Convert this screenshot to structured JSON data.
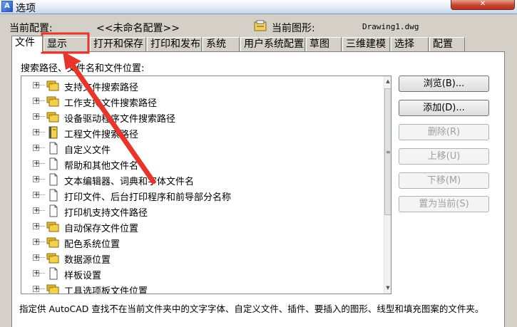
{
  "window": {
    "title": "选项",
    "app_icon_text": "A",
    "close_glyph": "✕"
  },
  "config": {
    "current_profile_label": "当前配置:",
    "current_profile_value": "<<未命名配置>>",
    "current_drawing_label": "当前图形:",
    "current_drawing_value": "Drawing1.dwg"
  },
  "tabs": [
    {
      "label": "文件"
    },
    {
      "label": "显示"
    },
    {
      "label": "打开和保存"
    },
    {
      "label": "打印和发布"
    },
    {
      "label": "系统"
    },
    {
      "label": "用户系统配置"
    },
    {
      "label": "草图"
    },
    {
      "label": "三维建模"
    },
    {
      "label": "选择"
    },
    {
      "label": "配置"
    }
  ],
  "active_tab": "文件",
  "highlighted_tab": "显示",
  "search_label": "搜索路径、文件名和文件位置:",
  "tree_items": [
    {
      "label": "支持文件搜索路径",
      "icon": "folder-stack-icon"
    },
    {
      "label": "工作支持文件搜索路径",
      "icon": "folder-stack-icon"
    },
    {
      "label": "设备驱动程序文件搜索路径",
      "icon": "folder-stack-icon"
    },
    {
      "label": "工程文件搜索路径",
      "icon": "book-icon"
    },
    {
      "label": "自定义文件",
      "icon": "document-icon"
    },
    {
      "label": "帮助和其他文件名",
      "icon": "document-icon"
    },
    {
      "label": "文本编辑器、词典和字体文件名",
      "icon": "document-icon"
    },
    {
      "label": "打印文件、后台打印程序和前导部分名称",
      "icon": "document-icon"
    },
    {
      "label": "打印机支持文件路径",
      "icon": "document-icon"
    },
    {
      "label": "自动保存文件位置",
      "icon": "folder-stack-icon"
    },
    {
      "label": "配色系统位置",
      "icon": "folder-stack-icon"
    },
    {
      "label": "数据源位置",
      "icon": "folder-stack-icon"
    },
    {
      "label": "样板设置",
      "icon": "document-icon"
    },
    {
      "label": "工具选项板文件位置",
      "icon": "folder-stack-icon"
    }
  ],
  "expander_glyph": "+",
  "scrollbar": {
    "up_glyph": "▲",
    "down_glyph": "▼",
    "grip_glyph": "≡"
  },
  "buttons": [
    {
      "label": "浏览(B)...",
      "enabled": true
    },
    {
      "label": "添加(D)...",
      "enabled": true
    },
    {
      "label": "删除(R)",
      "enabled": false
    },
    {
      "label": "上移(U)",
      "enabled": false
    },
    {
      "label": "下移(M)",
      "enabled": false
    },
    {
      "label": "置为当前(S)",
      "enabled": false
    }
  ],
  "description": "指定供 AutoCAD 查找不在当前文件夹中的文字字体、自定义文件、插件、要插入的图形、线型和填充图案的文件夹。",
  "colors": {
    "annotation_red": "#e8342a",
    "folder_yellow": "#f2d24a",
    "dialog_face": "#d4d0c8"
  }
}
